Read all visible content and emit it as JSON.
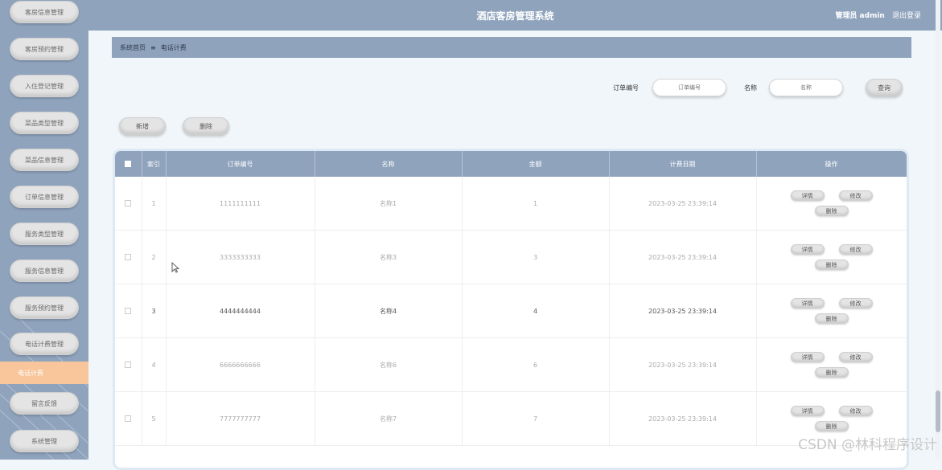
{
  "app": {
    "title": "酒店客房管理系统",
    "user": "管理员 admin",
    "logout": "退出登录"
  },
  "sidebar": {
    "items": [
      {
        "label": "客房信息管理"
      },
      {
        "label": "客房预约管理"
      },
      {
        "label": "入住登记管理"
      },
      {
        "label": "菜品类型管理"
      },
      {
        "label": "菜品信息管理"
      },
      {
        "label": "订单信息管理"
      },
      {
        "label": "服务类型管理"
      },
      {
        "label": "服务信息管理"
      },
      {
        "label": "服务预约管理"
      },
      {
        "label": "电话计费管理"
      },
      {
        "label": "留言反馈"
      },
      {
        "label": "系统管理"
      }
    ],
    "active": "电话计费"
  },
  "breadcrumb": {
    "home": "系统首页",
    "sep": "≡",
    "current": "电话计费"
  },
  "search": {
    "order_label": "订单编号",
    "order_placeholder": "订单编号",
    "name_label": "名称",
    "name_placeholder": "名称",
    "query_button": "查询"
  },
  "actions": {
    "add": "新增",
    "delete": "删除"
  },
  "table": {
    "headers": [
      "索引",
      "订单编号",
      "名称",
      "金额",
      "计费日期",
      "操作"
    ],
    "op_labels": {
      "detail": "详情",
      "edit": "修改",
      "delete": "删除"
    },
    "rows": [
      {
        "index": "1",
        "order_no": "1111111111",
        "name": "名称1",
        "amount": "1",
        "date": "2023-03-25 23:39:14"
      },
      {
        "index": "2",
        "order_no": "3333333333",
        "name": "名称3",
        "amount": "3",
        "date": "2023-03-25 23:39:14"
      },
      {
        "index": "3",
        "order_no": "4444444444",
        "name": "名称4",
        "amount": "4",
        "date": "2023-03-25 23:39:14"
      },
      {
        "index": "4",
        "order_no": "6666666666",
        "name": "名称6",
        "amount": "6",
        "date": "2023-03-25 23:39:14"
      },
      {
        "index": "5",
        "order_no": "7777777777",
        "name": "名称7",
        "amount": "7",
        "date": "2023-03-25 23:39:14"
      }
    ]
  },
  "watermark": "CSDN @林科程序设计"
}
